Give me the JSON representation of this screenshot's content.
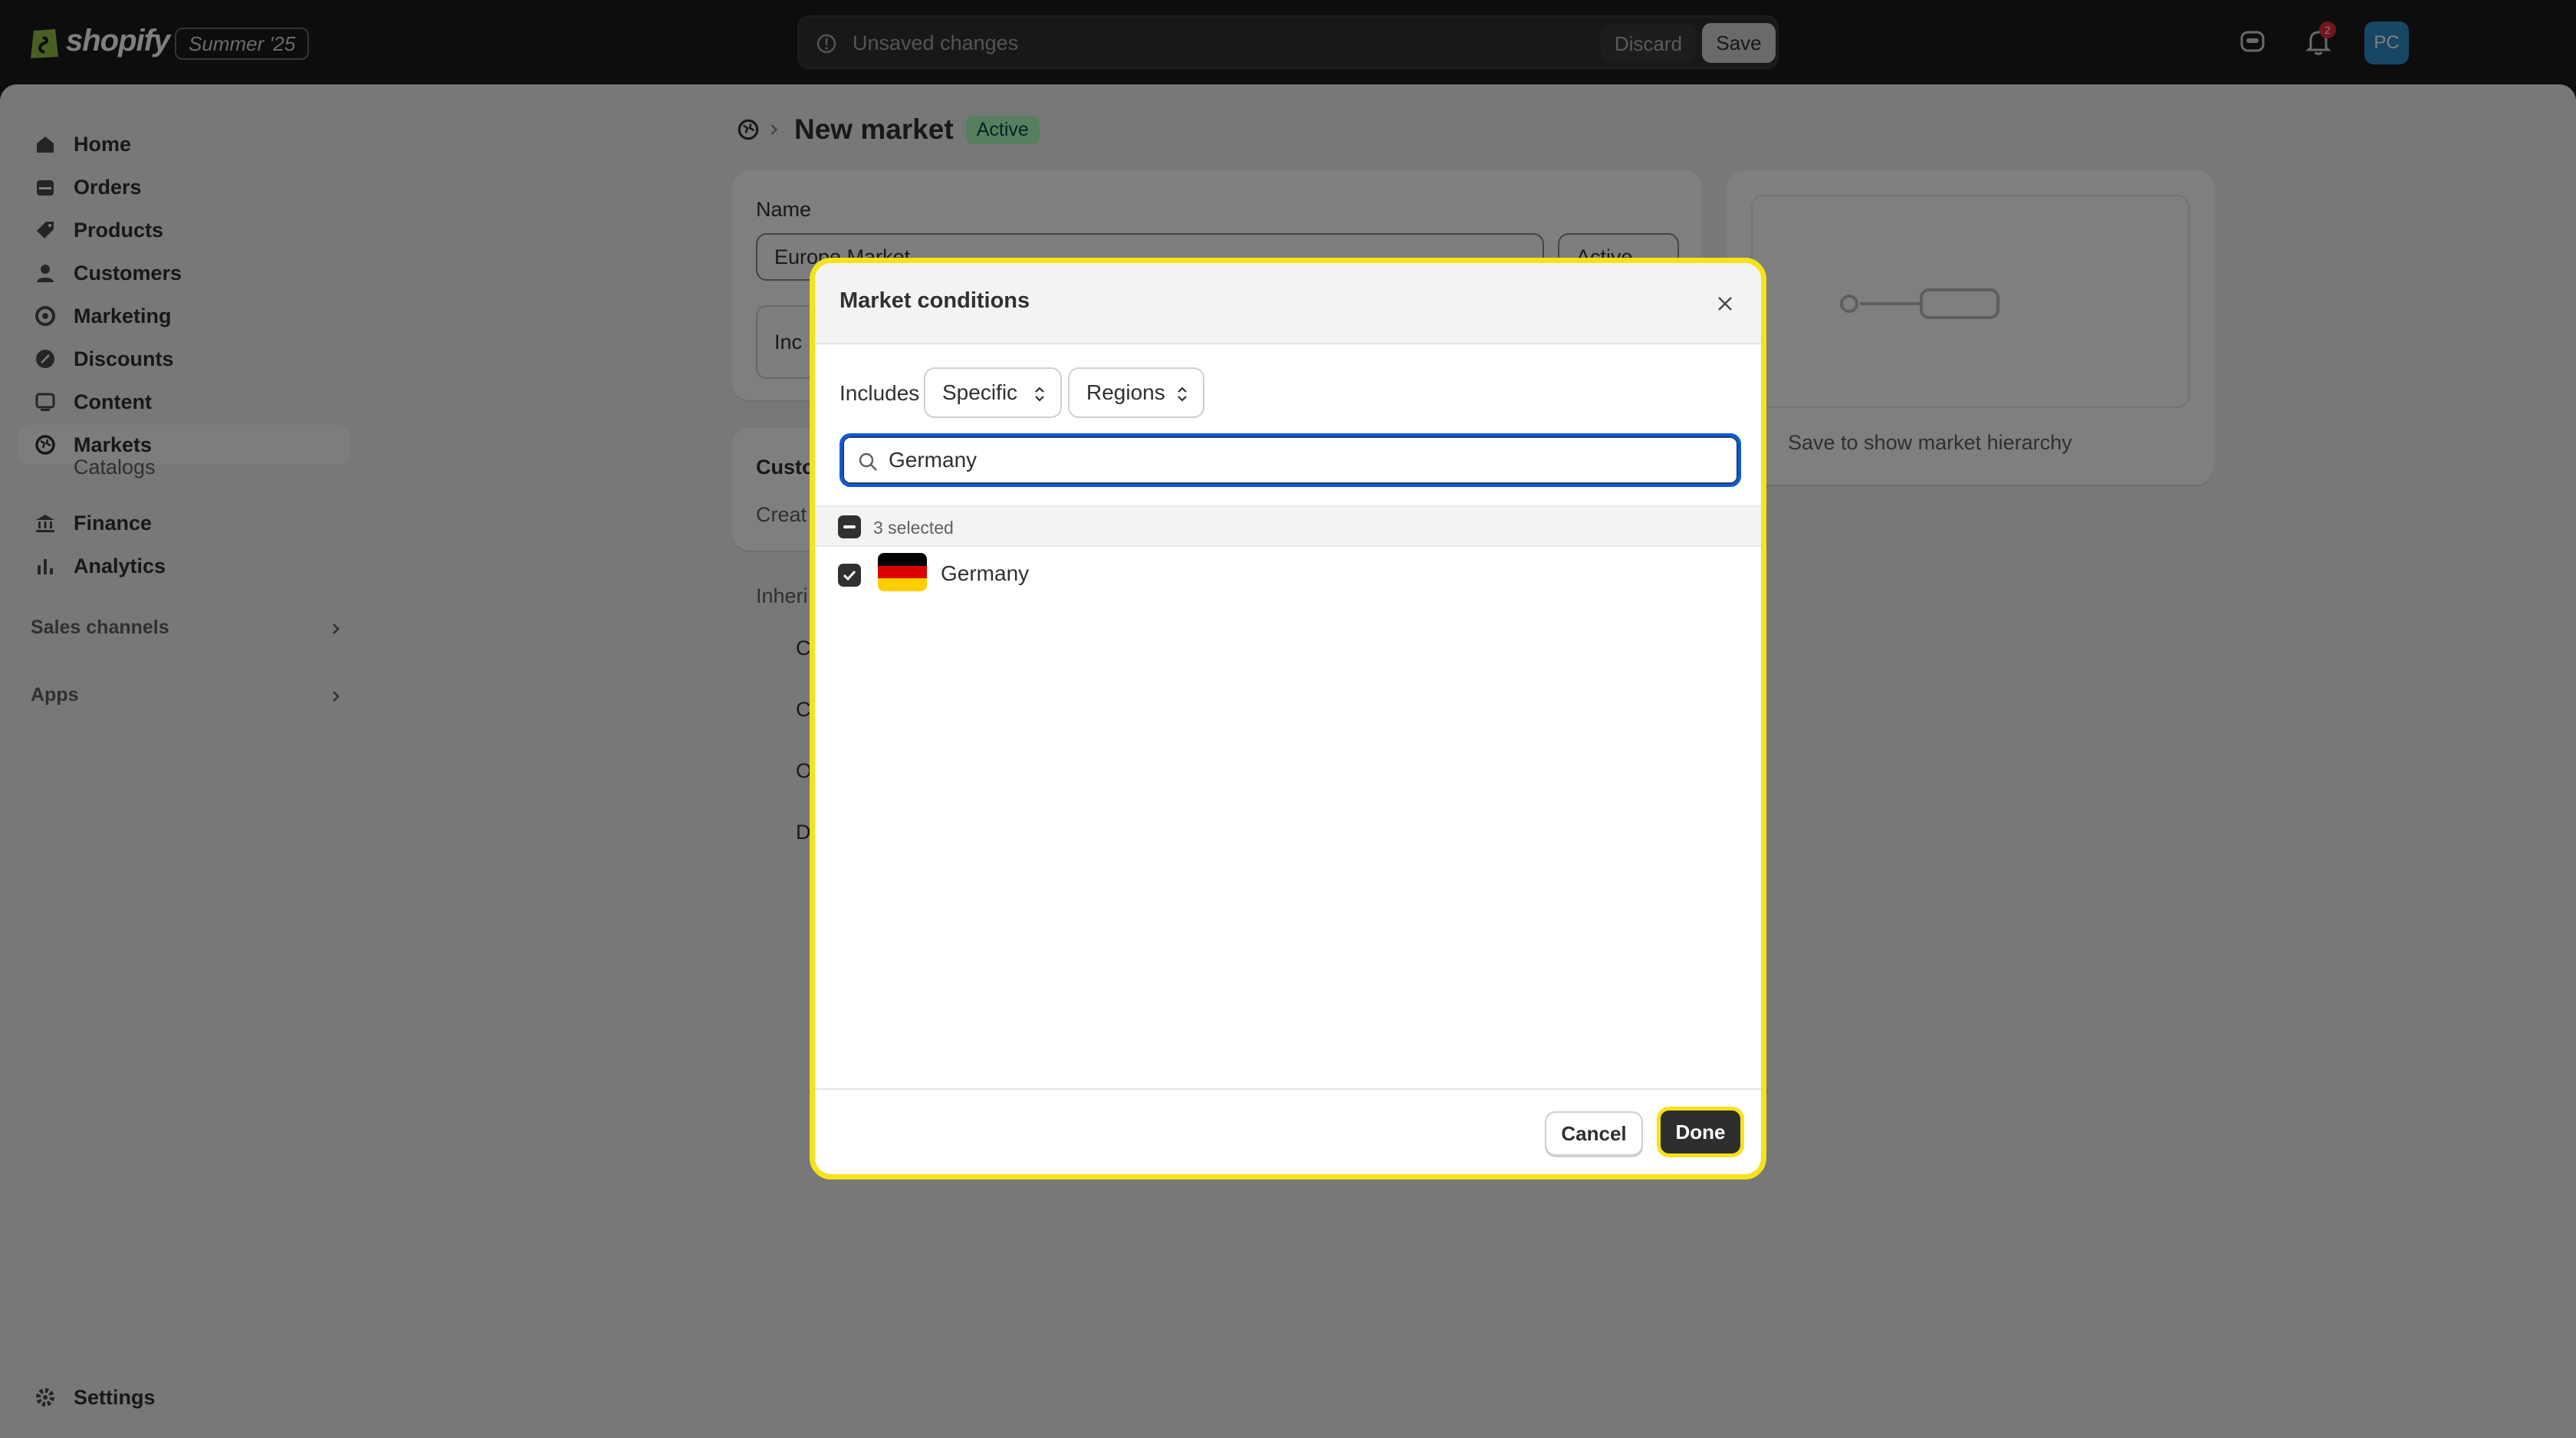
{
  "topbar": {
    "brand": "shopify",
    "season": "Summer '25",
    "unsaved_message": "Unsaved changes",
    "discard_label": "Discard",
    "save_label": "Save",
    "notification_count": "2",
    "avatar_initials": "PC"
  },
  "sidebar": {
    "items": [
      {
        "label": "Home",
        "icon": "home-icon"
      },
      {
        "label": "Orders",
        "icon": "orders-icon"
      },
      {
        "label": "Products",
        "icon": "tag-icon"
      },
      {
        "label": "Customers",
        "icon": "person-icon"
      },
      {
        "label": "Marketing",
        "icon": "target-icon"
      },
      {
        "label": "Discounts",
        "icon": "discount-icon"
      },
      {
        "label": "Content",
        "icon": "content-icon"
      },
      {
        "label": "Markets",
        "icon": "globe-icon"
      }
    ],
    "sub_catalogs": "Catalogs",
    "finance": "Finance",
    "analytics": "Analytics",
    "sales_channels": "Sales channels",
    "apps": "Apps",
    "settings": "Settings"
  },
  "page": {
    "title": "New market",
    "status": "Active",
    "name_label": "Name",
    "name_value": "Europe Market",
    "status_select": "Active",
    "includes_stub": "Inc",
    "customize_stub": "Custo",
    "create_stub": "Creat",
    "inherit_stub": "Inheri",
    "row_stubs": [
      "C",
      "C",
      "O",
      "D"
    ],
    "hierarchy_hint": "Save to show market hierarchy"
  },
  "modal": {
    "title": "Market conditions",
    "includes_label": "Includes",
    "scope_select": "Specific",
    "type_select": "Regions",
    "search_value": "Germany",
    "selected_count": "3 selected",
    "results": [
      {
        "country": "Germany",
        "checked": true,
        "flag_colors": [
          "#000000",
          "#dd0000",
          "#ffce00"
        ]
      }
    ],
    "cancel_label": "Cancel",
    "done_label": "Done"
  },
  "colors": {
    "accent_highlight": "#f6e21a",
    "active_badge_bg": "#affebf",
    "focus_ring": "#0b5ad8"
  }
}
